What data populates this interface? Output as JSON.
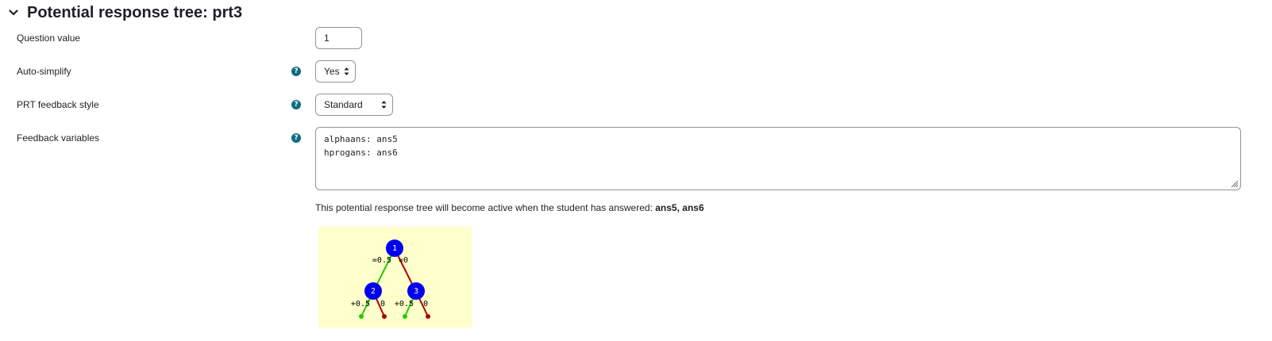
{
  "section": {
    "title": "Potential response tree: prt3"
  },
  "fields": {
    "question_value": {
      "label": "Question value",
      "value": "1"
    },
    "auto_simplify": {
      "label": "Auto-simplify",
      "value": "Yes"
    },
    "feedback_style": {
      "label": "PRT feedback style",
      "value": "Standard"
    },
    "feedback_variables": {
      "label": "Feedback variables",
      "lines": [
        "alphaans: ans5",
        "hprogans: ans6"
      ]
    }
  },
  "info": {
    "prefix": "This potential response tree will become active when the student has answered: ",
    "answers": "ans5, ans6"
  },
  "tree": {
    "nodes": [
      "1",
      "2",
      "3"
    ],
    "edge_labels": {
      "n1_true": "=0.5",
      "n1_false": "=0",
      "n2_true": "+0.5",
      "n2_false": "0",
      "n3_true": "+0.5",
      "n3_false": "0"
    },
    "colors": {
      "background": "#ffffcc",
      "node": "#0000ee",
      "true_branch": "#22cc00",
      "false_branch": "#aa0000"
    }
  },
  "icons": {
    "collapse": "chevron-down-icon",
    "help": "question-circle-icon",
    "select": "sort-arrows-icon"
  }
}
